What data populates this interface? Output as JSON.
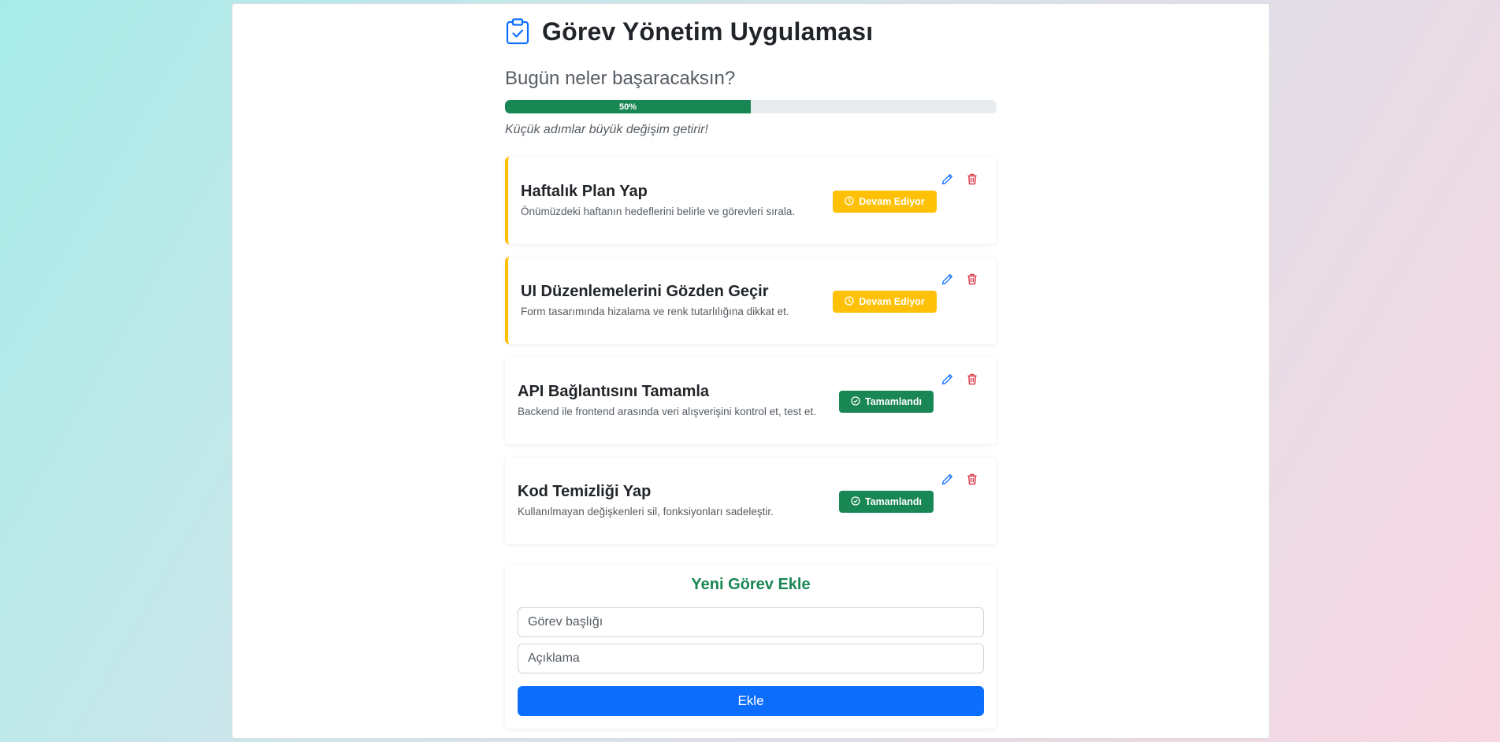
{
  "app": {
    "title": "Görev Yönetim Uygulaması",
    "icon": "clipboard-check-icon",
    "subtitle": "Bugün neler başaracaksın?",
    "progress_percent": 50,
    "progress_label": "50%",
    "motto": "Küçük adımlar büyük değişim getirir!"
  },
  "colors": {
    "accent_blue": "#0d6efd",
    "success_green": "#198754",
    "warning_yellow": "#ffc107",
    "delete_red": "#dc3545"
  },
  "tasks": [
    {
      "title": "Haftalık Plan Yap",
      "description": "Önümüzdeki haftanın hedeflerini belirle ve görevleri sırala.",
      "status": "Devam Ediyor",
      "state": "pending",
      "status_icon": "clock-icon"
    },
    {
      "title": "UI Düzenlemelerini Gözden Geçir",
      "description": "Form tasarımında hizalama ve renk tutarlılığına dikkat et.",
      "status": "Devam Ediyor",
      "state": "pending",
      "status_icon": "clock-icon"
    },
    {
      "title": "API Bağlantısını Tamamla",
      "description": "Backend ile frontend arasında veri alışverişini kontrol et, test et.",
      "status": "Tamamlandı",
      "state": "done",
      "status_icon": "check-circle-icon"
    },
    {
      "title": "Kod Temizliği Yap",
      "description": "Kullanılmayan değişkenleri sil, fonksiyonları sadeleştir.",
      "status": "Tamamlandı",
      "state": "done",
      "status_icon": "check-circle-icon"
    }
  ],
  "form": {
    "heading": "Yeni Görev Ekle",
    "title_placeholder": "Görev başlığı",
    "title_value": "",
    "desc_placeholder": "Açıklama",
    "desc_value": "",
    "submit_label": "Ekle"
  }
}
